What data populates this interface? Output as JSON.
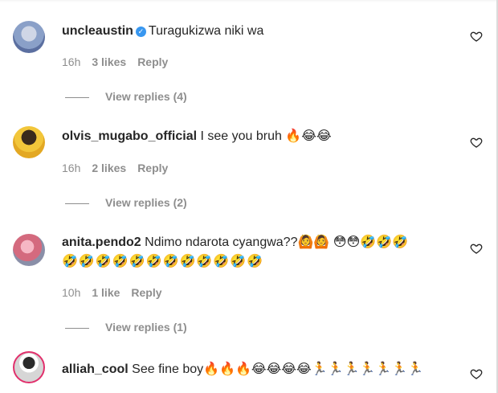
{
  "comments": [
    {
      "username": "uncleaustin",
      "verified": true,
      "text": "Turagukizwa niki wa",
      "emoji_line": "",
      "time": "16h",
      "likes": "3 likes",
      "reply": "Reply",
      "view_replies": "View replies (4)"
    },
    {
      "username": "olvis_mugabo_official",
      "verified": false,
      "text": "I see you bruh 🔥😂😂",
      "emoji_line": "",
      "time": "16h",
      "likes": "2 likes",
      "reply": "Reply",
      "view_replies": "View replies (2)"
    },
    {
      "username": "anita.pendo2",
      "verified": false,
      "text": "Ndimo ndarota cyangwa??🙆🙆 😳😳🤣🤣🤣",
      "emoji_line": "🤣🤣🤣🤣🤣🤣🤣🤣🤣🤣🤣🤣",
      "time": "10h",
      "likes": "1 like",
      "reply": "Reply",
      "view_replies": "View replies (1)"
    },
    {
      "username": "alliah_cool",
      "verified": false,
      "text": "See fine boy🔥🔥🔥😂😂😂😂🏃🏃🏃🏃🏃🏃🏃",
      "emoji_line": "",
      "time": "",
      "likes": "",
      "reply": "",
      "view_replies": ""
    }
  ],
  "icons": {
    "like": "heart-outline-icon",
    "verified": "verified-badge-icon"
  },
  "colors": {
    "text": "#262626",
    "muted": "#8e8e8e",
    "verified": "#3897f0"
  }
}
